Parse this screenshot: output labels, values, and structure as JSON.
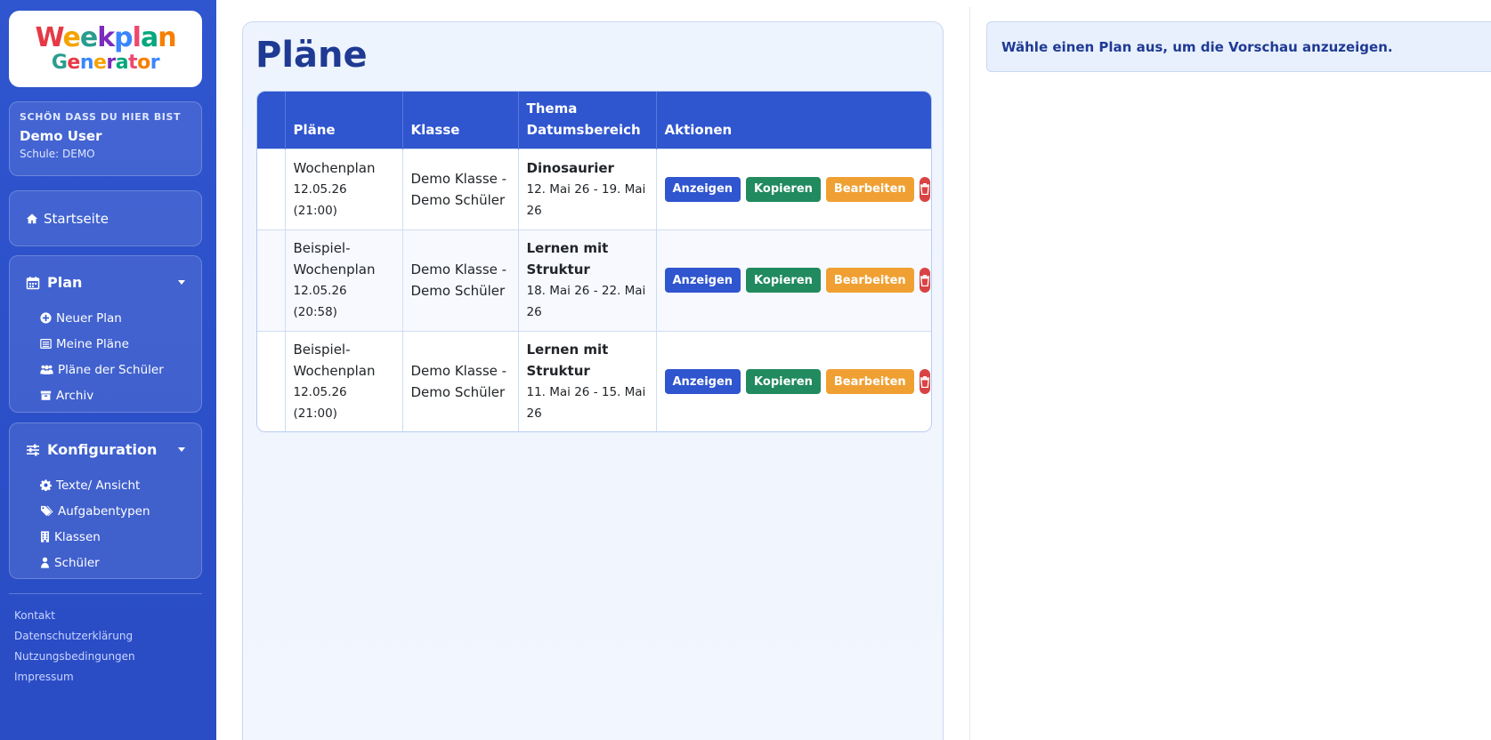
{
  "sidebar": {
    "logo": {
      "line1": "Weekplan",
      "line2": "Generator"
    },
    "welcome": {
      "kicker": "SCHÖN DASS DU HIER BIST",
      "name": "Demo User",
      "school": "Schule: DEMO"
    },
    "home": {
      "label": "Startseite",
      "icon": "home-icon"
    },
    "plan_section": {
      "label": "Plan",
      "icon": "calendar-icon",
      "items": [
        {
          "label": "Neuer Plan",
          "icon": "plus-circle-icon"
        },
        {
          "label": "Meine Pläne",
          "icon": "list-icon"
        },
        {
          "label": "Pläne der Schüler",
          "icon": "users-icon"
        },
        {
          "label": "Archiv",
          "icon": "archive-icon"
        }
      ]
    },
    "config_section": {
      "label": "Konfiguration",
      "icon": "sliders-icon",
      "items": [
        {
          "label": "Texte/ Ansicht",
          "icon": "gear-icon"
        },
        {
          "label": "Aufgabentypen",
          "icon": "tags-icon"
        },
        {
          "label": "Klassen",
          "icon": "building-icon"
        },
        {
          "label": "Schüler",
          "icon": "user-icon"
        }
      ]
    },
    "footer": [
      "Kontakt",
      "Datenschutzerklärung",
      "Nutzungsbedingungen",
      "Impressum"
    ]
  },
  "main": {
    "title": "Pläne",
    "table": {
      "headers": {
        "plans": "Pläne",
        "class": "Klasse",
        "theme_line1": "Thema",
        "theme_line2": "Datumsbereich",
        "actions": "Aktionen"
      },
      "rows": [
        {
          "name": "Wochenplan",
          "created": "12.05.26 (21:00)",
          "class": "Demo Klasse - Demo Schüler",
          "theme": "Dinosaurier",
          "range": "12. Mai 26 - 19. Mai 26"
        },
        {
          "name": "Beispiel-Wochenplan",
          "created": "12.05.26 (20:58)",
          "class": "Demo Klasse - Demo Schüler",
          "theme": "Lernen mit Struktur",
          "range": "18. Mai 26 - 22. Mai 26"
        },
        {
          "name": "Beispiel-Wochenplan",
          "created": "12.05.26 (21:00)",
          "class": "Demo Klasse - Demo Schüler",
          "theme": "Lernen mit Struktur",
          "range": "11. Mai 26 - 15. Mai 26"
        }
      ],
      "actions": {
        "show": "Anzeigen",
        "copy": "Kopieren",
        "edit": "Bearbeiten",
        "delete_icon": "trash-icon"
      }
    }
  },
  "preview": {
    "message": "Wähle einen Plan aus, um die Vorschau anzuzeigen."
  },
  "colors": {
    "primary": "#2f55cf",
    "copy": "#218a5f",
    "edit": "#f0a032",
    "delete": "#d94343",
    "title": "#1f3a93"
  }
}
